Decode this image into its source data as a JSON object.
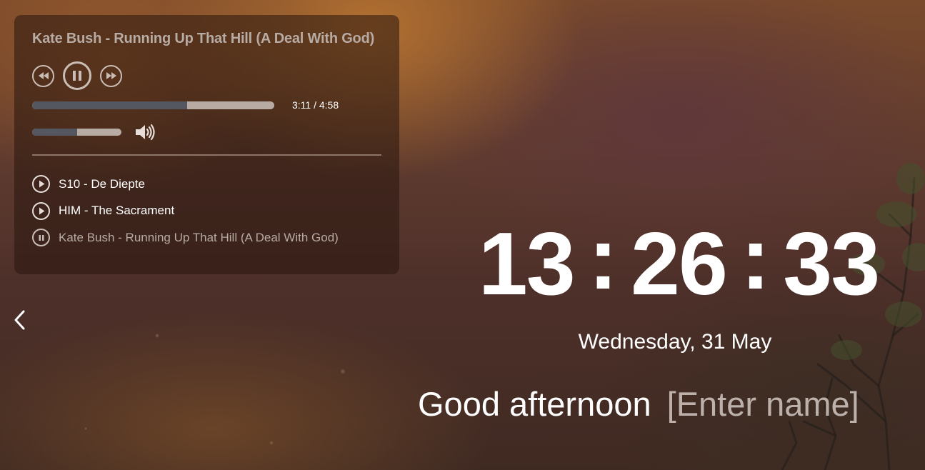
{
  "player": {
    "now_playing_title": "Kate Bush - Running Up That Hill (A Deal With God)",
    "progress_fraction": 0.64,
    "time_display": "3:11 / 4:58",
    "volume_fraction": 0.5,
    "playlist": [
      {
        "name": "S10 - De Diepte",
        "state": "play"
      },
      {
        "name": "HIM - The Sacrament",
        "state": "play"
      },
      {
        "name": "Kate Bush - Running Up That Hill (A Deal With God)",
        "state": "pause"
      }
    ]
  },
  "clock": {
    "hours": "13",
    "minutes": "26",
    "seconds": "33",
    "separator": ":"
  },
  "date": "Wednesday, 31 May",
  "greeting": {
    "text": "Good afternoon",
    "name_placeholder": "[Enter name]"
  },
  "colors": {
    "progress_fill": "#545760",
    "progress_track": "#b7aba4",
    "text_primary": "#ffffff",
    "text_muted": "#b7aba4"
  }
}
